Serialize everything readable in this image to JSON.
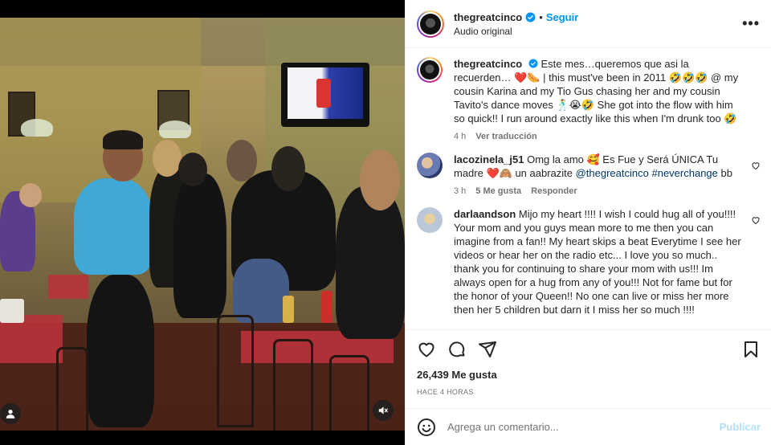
{
  "post": {
    "username": "thegreatcinco",
    "follow_label": "Seguir",
    "separator": "•",
    "audio_label": "Audio original",
    "more_label": "•••"
  },
  "comments": [
    {
      "username": "thegreatcinco",
      "text_parts": [
        "Este mes…queremos que asi la recuerden… ",
        "❤️🌭",
        " | this must've been in 2011 🤣🤣🤣 @ my cousin Karina and my Tio Gus chasing her and my cousin Tavito's dance moves 🕺😭🤣 She got into the flow with him so quick!! I run around exactly like this when I'm drunk too 🤣"
      ],
      "time": "4 h",
      "action": "Ver traducción"
    },
    {
      "username": "lacozinela_j51",
      "text_a": "Omg la amo 🥰 Es Fue y Será ÚNICA Tu madre ❤️🙈 un aabrazite ",
      "mention": "@thegreatcinco",
      "hashtag": "#neverchange",
      "text_b": " bb",
      "time": "3 h",
      "likes": "5 Me gusta",
      "action": "Responder"
    },
    {
      "username": "darlaandson",
      "text": "Mijo my heart !!!! I wish I could hug all of you!!!! Your mom and you guys mean more to me then you can imagine from a fan!! My heart skips a beat Everytime I see her videos or hear her on the radio etc... I love you so much.. thank you for continuing to share your mom with us!!! Im always open for a hug from any of you!!! Not for fame but for the honor of your Queen!! No one can live or miss her more then her 5 children but darn it I miss her so much !!!!"
    }
  ],
  "likes": "26,439 Me gusta",
  "timestamp": "HACE 4 HORAS",
  "composer": {
    "placeholder": "Agrega un comentario...",
    "publish_label": "Publicar"
  },
  "colors": {
    "accent": "#0095f6",
    "link": "#00376b",
    "muted": "#737373",
    "publish_disabled": "#b2dffc"
  },
  "icons": [
    "heart-icon",
    "comment-icon",
    "share-icon",
    "bookmark-icon",
    "emoji-icon",
    "verified-badge-icon",
    "user-tag-icon",
    "mute-icon",
    "more-options-icon"
  ]
}
